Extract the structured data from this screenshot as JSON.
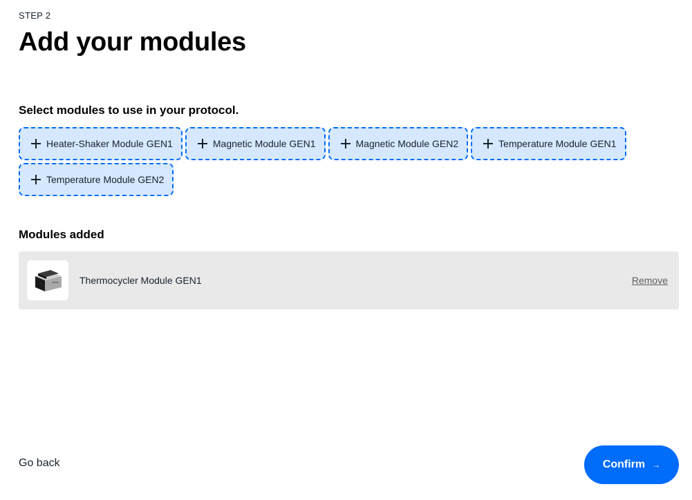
{
  "header": {
    "step_label": "STEP 2",
    "title": "Add your modules"
  },
  "select_section": {
    "heading": "Select modules to use in your protocol.",
    "modules": [
      {
        "label": "Heater-Shaker Module GEN1",
        "icon": "plus-icon"
      },
      {
        "label": "Magnetic Module GEN1",
        "icon": "plus-icon"
      },
      {
        "label": "Magnetic Module GEN2",
        "icon": "plus-icon"
      },
      {
        "label": "Temperature Module GEN1",
        "icon": "plus-icon"
      },
      {
        "label": "Temperature Module GEN2",
        "icon": "plus-icon"
      }
    ]
  },
  "added_section": {
    "heading": "Modules added",
    "items": [
      {
        "name": "Thermocycler Module GEN1",
        "remove_label": "Remove",
        "image": "thermocycler-module-image"
      }
    ]
  },
  "footer": {
    "back_label": "Go back",
    "confirm_label": "Confirm",
    "confirm_icon": "arrow-right-icon"
  },
  "colors": {
    "accent": "#006cfa",
    "chip_background": "#d6e8ff",
    "added_row_background": "#e9e9e9"
  }
}
